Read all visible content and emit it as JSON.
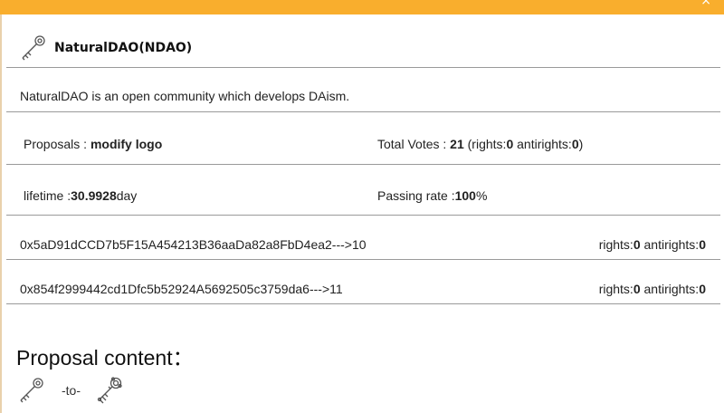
{
  "window": {
    "close_glyph": "×"
  },
  "header": {
    "title": "NaturalDAO(NDAO)",
    "logo_icon": "key-icon"
  },
  "description": "NaturalDAO is an open community which develops DAism.",
  "proposal": {
    "label": "Proposals : ",
    "value": "modify logo",
    "total_votes_label": "Total Votes : ",
    "total_votes_value": "21",
    "rights_open": " (rights:",
    "rights_value": "0",
    "antirights_label": " antirights:",
    "antirights_value": "0",
    "close_paren": ")"
  },
  "lifetime": {
    "label": "lifetime :",
    "value": "30.9928",
    "unit": "day",
    "passing_label": "Passing rate :",
    "passing_value": "100",
    "passing_unit": "%"
  },
  "votes": [
    {
      "address": "0x5aD91dCCD7b5F15A454213B36aaDa82a8FbD4ea2--->10",
      "rights_label": "rights:",
      "rights": "0",
      "antirights_label": " antirights:",
      "antirights": "0"
    },
    {
      "address": "0x854f2999442cd1Dfc5b52924A5692505c3759da6--->11",
      "rights_label": "rights:",
      "rights": "0",
      "antirights_label": " antirights:",
      "antirights": "0"
    }
  ],
  "content": {
    "title": "Proposal content：",
    "from_icon": "key-icon",
    "to_text": "-to-",
    "to_icon": "ornate-key-icon"
  }
}
